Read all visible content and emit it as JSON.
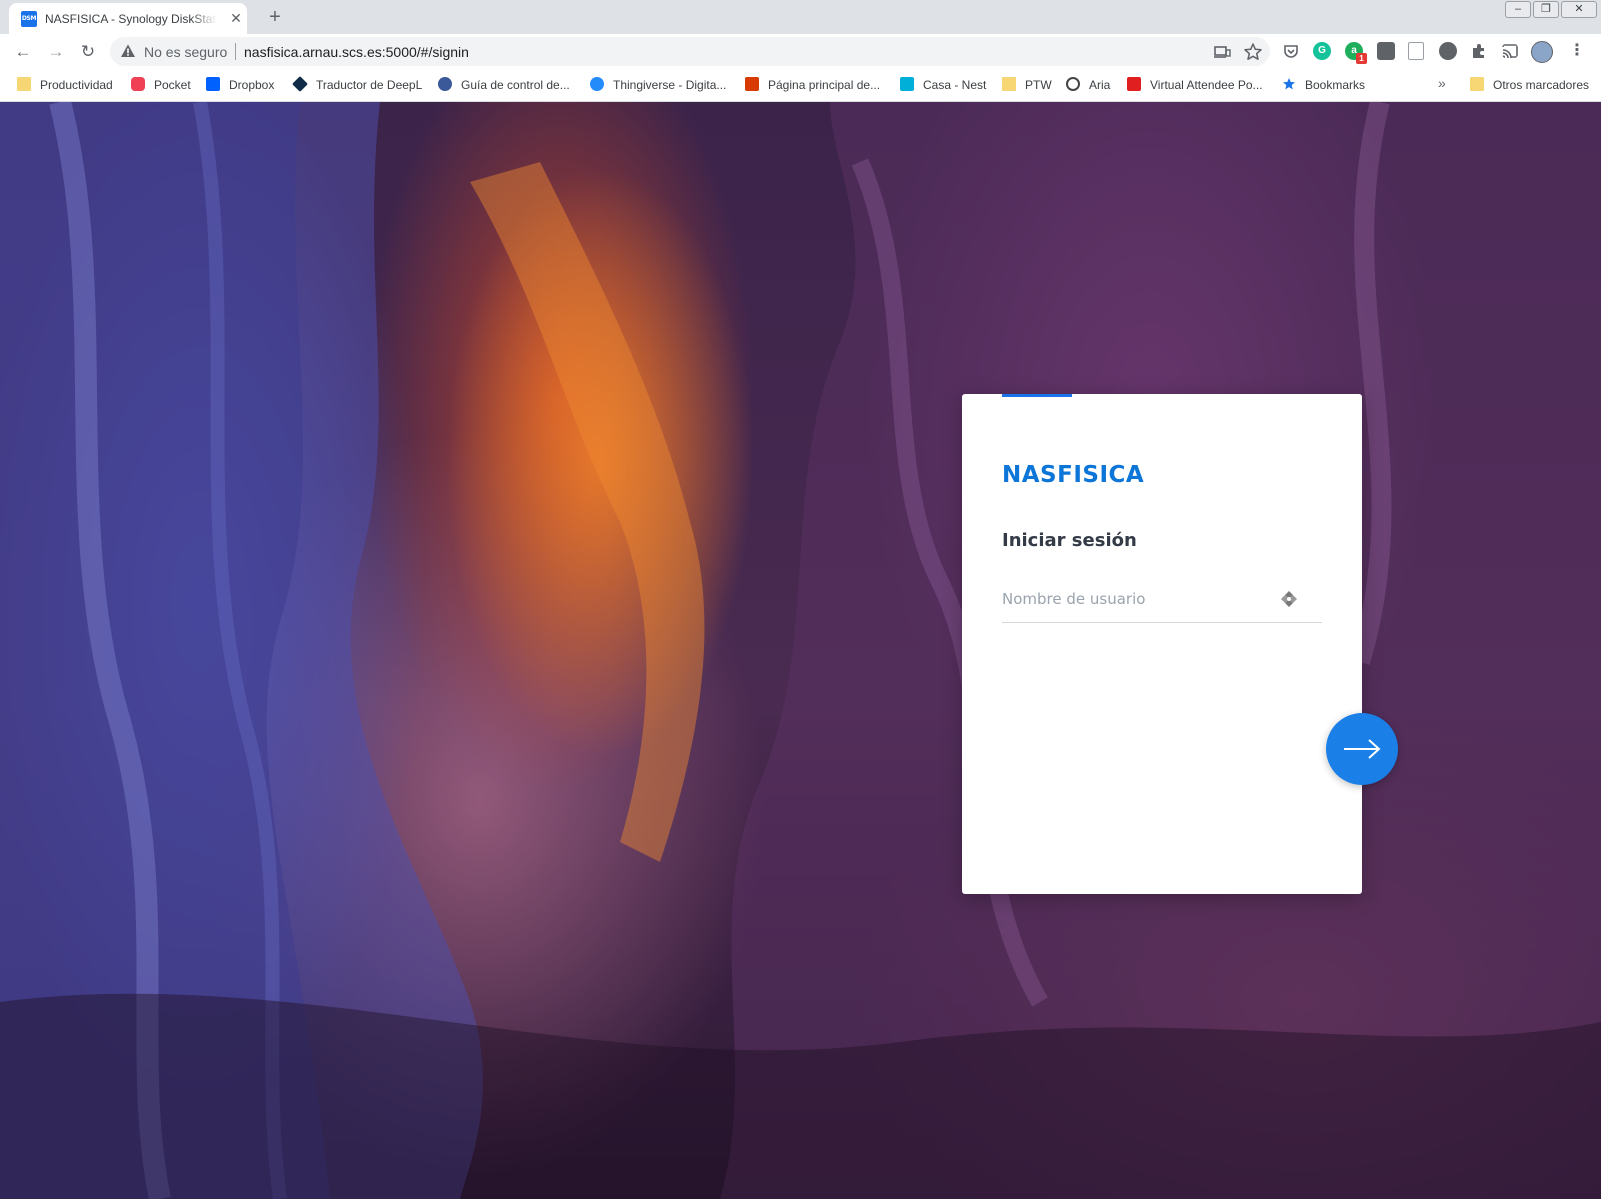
{
  "browser": {
    "tab": {
      "favicon_text": "DSM",
      "title": "NASFISICA - Synology DiskStation",
      "close": "✕"
    },
    "new_tab": "+",
    "window_controls": {
      "minimize": "–",
      "restore": "❐",
      "close": "✕"
    },
    "nav": {
      "back": "←",
      "forward": "→",
      "reload": "↻"
    },
    "omnibox": {
      "security_text": "No es seguro",
      "url": "nasfisica.arnau.scs.es:5000/#/signin"
    },
    "extensions_badge": "1",
    "bookmarks": [
      {
        "label": "Productividad",
        "icon": "folder-icon",
        "color": "#f7d774"
      },
      {
        "label": "Pocket",
        "icon": "pocket-icon",
        "color": "#ef4056"
      },
      {
        "label": "Dropbox",
        "icon": "dropbox-icon",
        "color": "#0061fe"
      },
      {
        "label": "Traductor de DeepL",
        "icon": "deepl-icon",
        "color": "#0f2b46"
      },
      {
        "label": "Guía de control de...",
        "icon": "guide-icon",
        "color": "#3b5998"
      },
      {
        "label": "Thingiverse - Digita...",
        "icon": "thingiverse-icon",
        "color": "#248bfb"
      },
      {
        "label": "Página principal de...",
        "icon": "office-icon",
        "color": "#d83b01"
      },
      {
        "label": "Casa - Nest",
        "icon": "nest-icon",
        "color": "#00afd8"
      },
      {
        "label": "PTW",
        "icon": "folder-icon",
        "color": "#f7d774"
      },
      {
        "label": "Aria",
        "icon": "aria-icon",
        "color": "#444444"
      },
      {
        "label": "Virtual Attendee Po...",
        "icon": "attendee-icon",
        "color": "#e02020"
      },
      {
        "label": "Bookmarks",
        "icon": "star-icon",
        "color": "#1a73e8"
      }
    ],
    "bookmarks_more": "»",
    "other_bookmarks": "Otros marcadores"
  },
  "login": {
    "server_name": "NASFISICA",
    "title": "Iniciar sesión",
    "username_placeholder": "Nombre de usuario",
    "username_value": ""
  },
  "colors": {
    "accent": "#1a73e8",
    "server_name": "#0b75d8",
    "next_button": "#1a7fe6"
  }
}
